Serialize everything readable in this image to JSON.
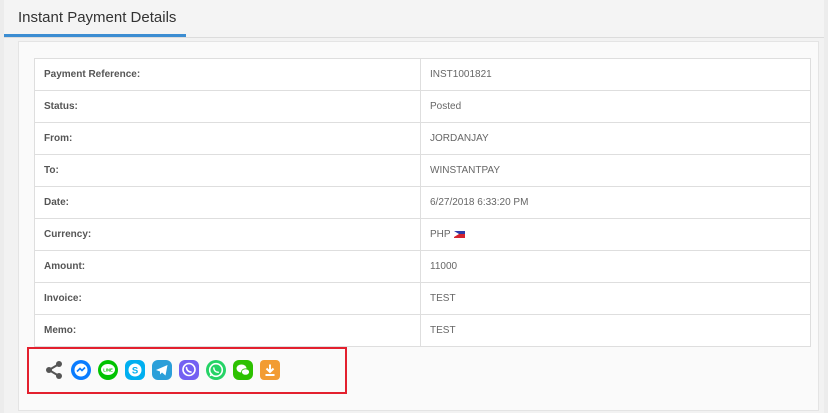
{
  "header": {
    "title": "Instant Payment Details"
  },
  "details": {
    "rows": [
      {
        "label": "Payment Reference:",
        "value": "INST1001821"
      },
      {
        "label": "Status:",
        "value": "Posted"
      },
      {
        "label": "From:",
        "value": "JORDANJAY"
      },
      {
        "label": "To:",
        "value": "WINSTANTPAY"
      },
      {
        "label": "Date:",
        "value": "6/27/2018 6:33:20 PM"
      },
      {
        "label": "Currency:",
        "value": "PHP"
      },
      {
        "label": "Amount:",
        "value": "11000"
      },
      {
        "label": "Invoice:",
        "value": "TEST"
      },
      {
        "label": "Memo:",
        "value": "TEST"
      }
    ]
  },
  "share": {
    "icons": [
      "share-icon",
      "messenger-icon",
      "line-icon",
      "skype-icon",
      "telegram-icon",
      "viber-icon",
      "whatsapp-icon",
      "wechat-icon",
      "download-icon"
    ]
  },
  "colors": {
    "accent": "#3c8dd2",
    "highlight_border": "#e3202e",
    "messenger": "#0a7cff",
    "line": "#00c300",
    "skype": "#00aff0",
    "telegram": "#2b9fd9",
    "viber": "#7360f2",
    "whatsapp": "#25d366",
    "wechat": "#2dc100",
    "download": "#f29c33"
  }
}
